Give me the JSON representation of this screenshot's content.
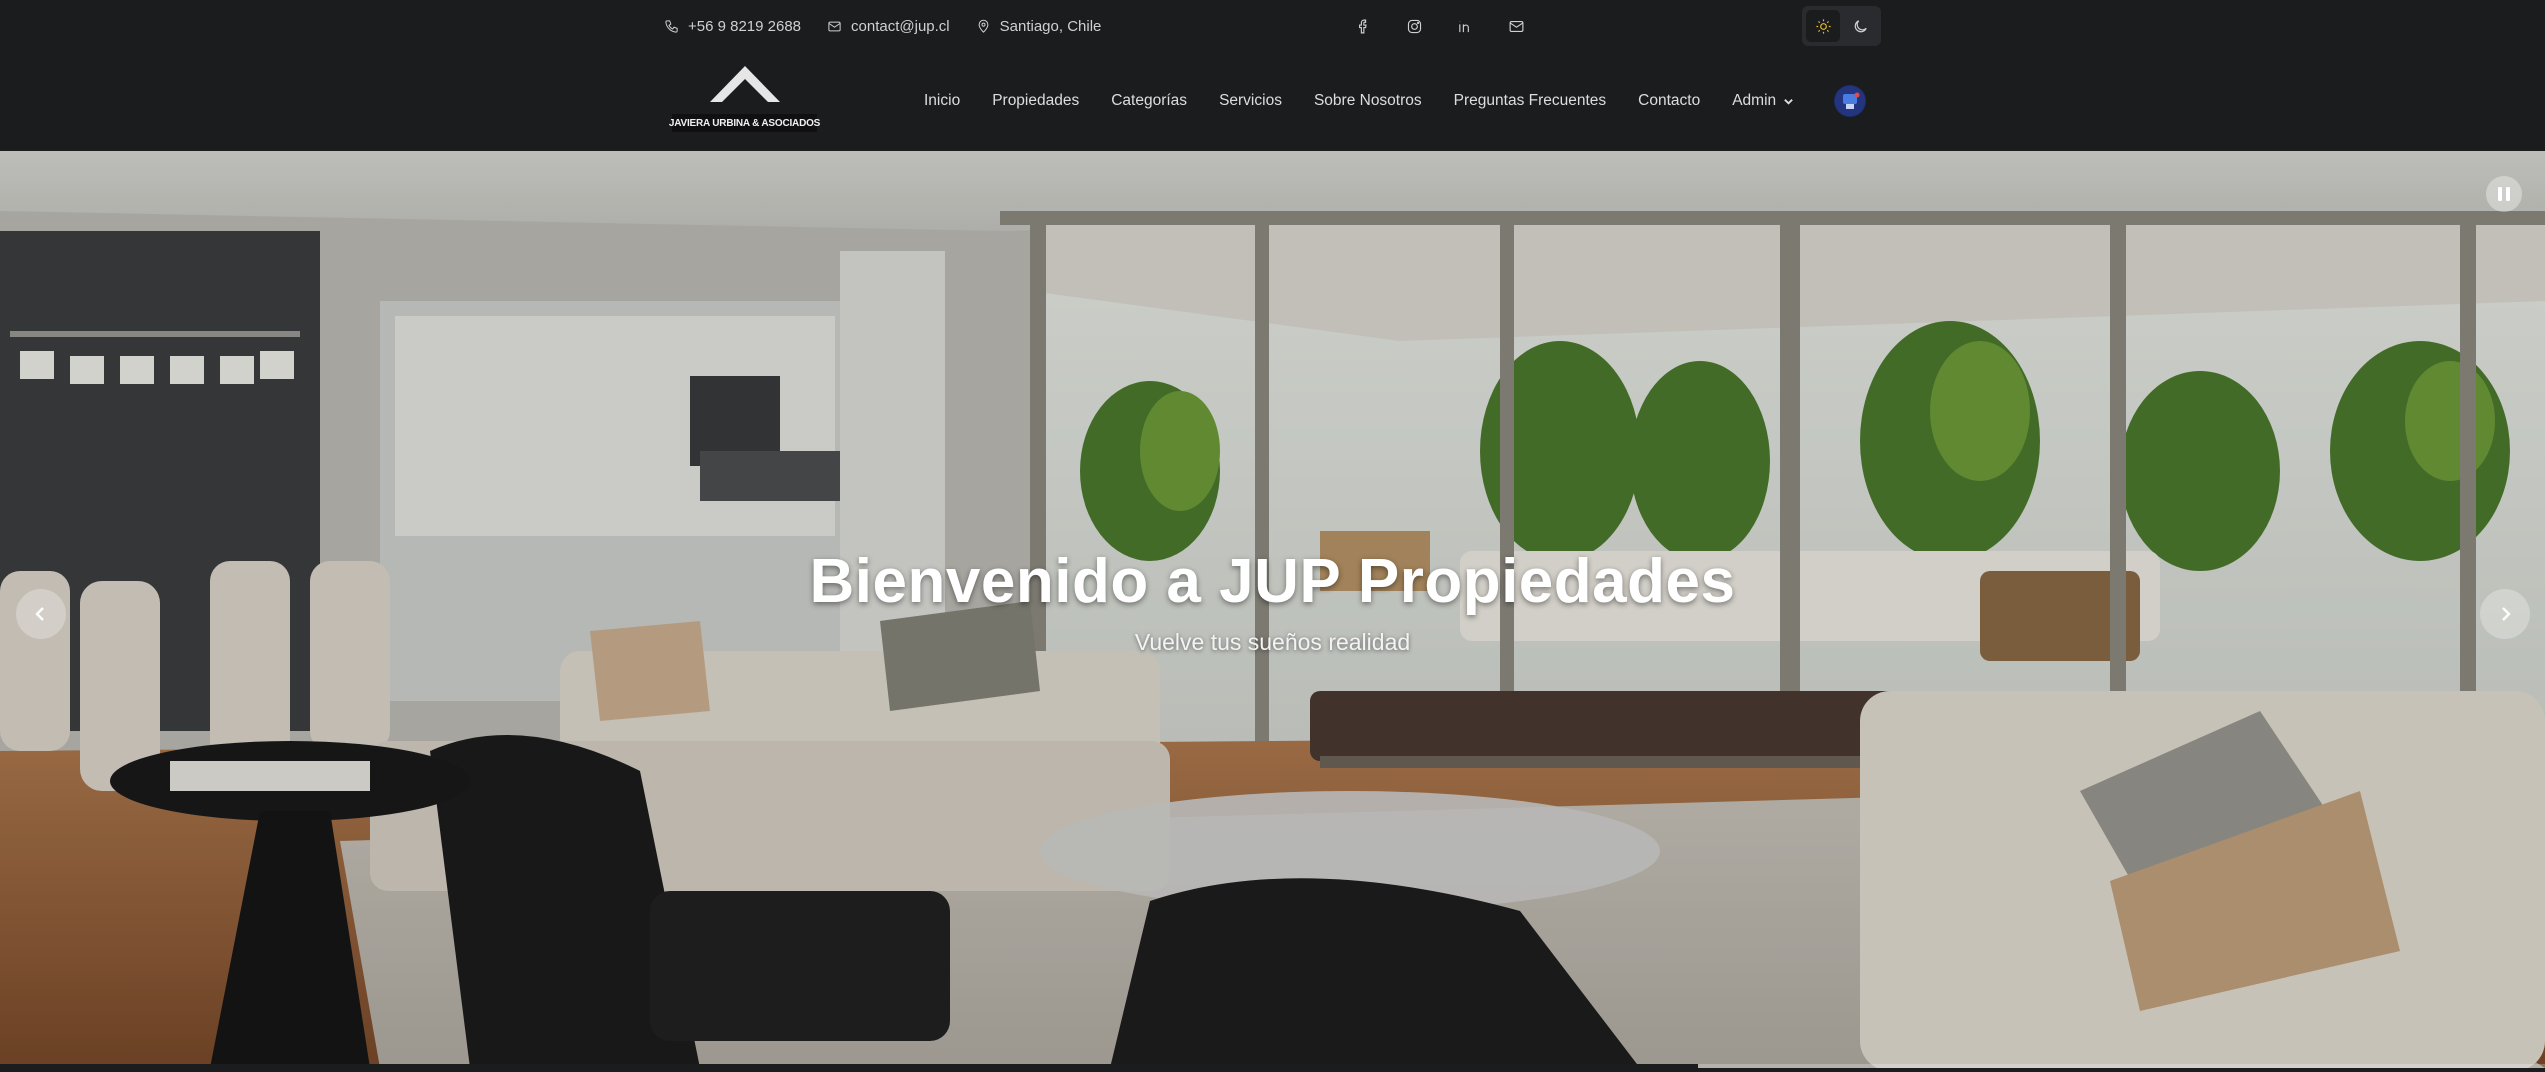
{
  "topbar": {
    "phone": "+56 9 8219 2688",
    "email": "contact@jup.cl",
    "location": "Santiago, Chile",
    "social_icons": [
      "facebook-icon",
      "instagram-icon",
      "linkedin-icon",
      "mail-icon"
    ]
  },
  "theme": {
    "active": "light",
    "light_icon": "sun-icon",
    "dark_icon": "moon-icon",
    "accent": "#e8b923"
  },
  "brand": {
    "logo_text": "JAVIERA URBINA & ASOCIADOS"
  },
  "nav": {
    "items": [
      {
        "label": "Inicio"
      },
      {
        "label": "Propiedades"
      },
      {
        "label": "Categorías"
      },
      {
        "label": "Servicios"
      },
      {
        "label": "Sobre Nosotros"
      },
      {
        "label": "Preguntas Frecuentes"
      },
      {
        "label": "Contacto"
      },
      {
        "label": "Admin"
      }
    ]
  },
  "hero": {
    "title": "Bienvenido a JUP Propiedades",
    "subtitle": "Vuelve tus sueños realidad",
    "slide_progress": 0.667
  },
  "colors": {
    "background": "#1b1c1e",
    "text": "#d9dadc"
  }
}
